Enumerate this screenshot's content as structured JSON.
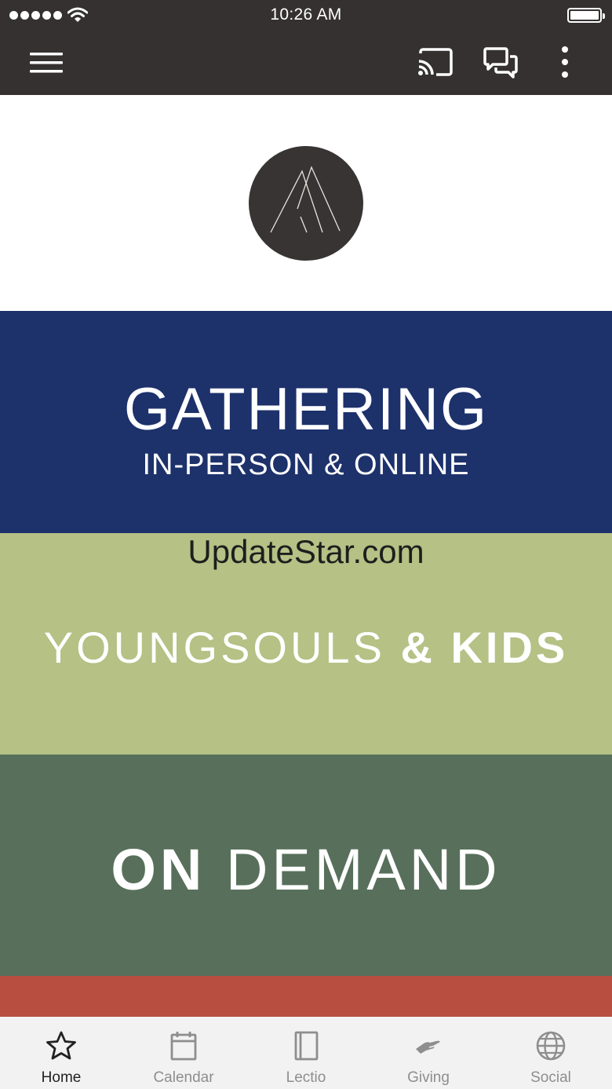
{
  "status_bar": {
    "time": "10:26 AM"
  },
  "app_bar": {
    "icons": [
      "menu-icon",
      "cast-icon",
      "chat-icon",
      "more-vertical-icon"
    ]
  },
  "tiles": {
    "gathering": {
      "title": "GATHERING",
      "subtitle": "IN-PERSON & ONLINE",
      "color": "#1d316b"
    },
    "kids": {
      "title_light": "YOUNGSOULS ",
      "title_bold": "& KIDS",
      "color": "#b5c185"
    },
    "on_demand": {
      "title_bold": "ON ",
      "title_light": "DEMAND",
      "color": "#58705b"
    },
    "next": {
      "color": "#b74e3f"
    }
  },
  "watermark": "UpdateStar.com",
  "tab_bar": {
    "tabs": [
      {
        "label": "Home",
        "icon": "star-icon",
        "active": true
      },
      {
        "label": "Calendar",
        "icon": "calendar-icon",
        "active": false
      },
      {
        "label": "Lectio",
        "icon": "book-icon",
        "active": false
      },
      {
        "label": "Giving",
        "icon": "giving-hand-icon",
        "active": false
      },
      {
        "label": "Social",
        "icon": "globe-icon",
        "active": false
      }
    ]
  }
}
